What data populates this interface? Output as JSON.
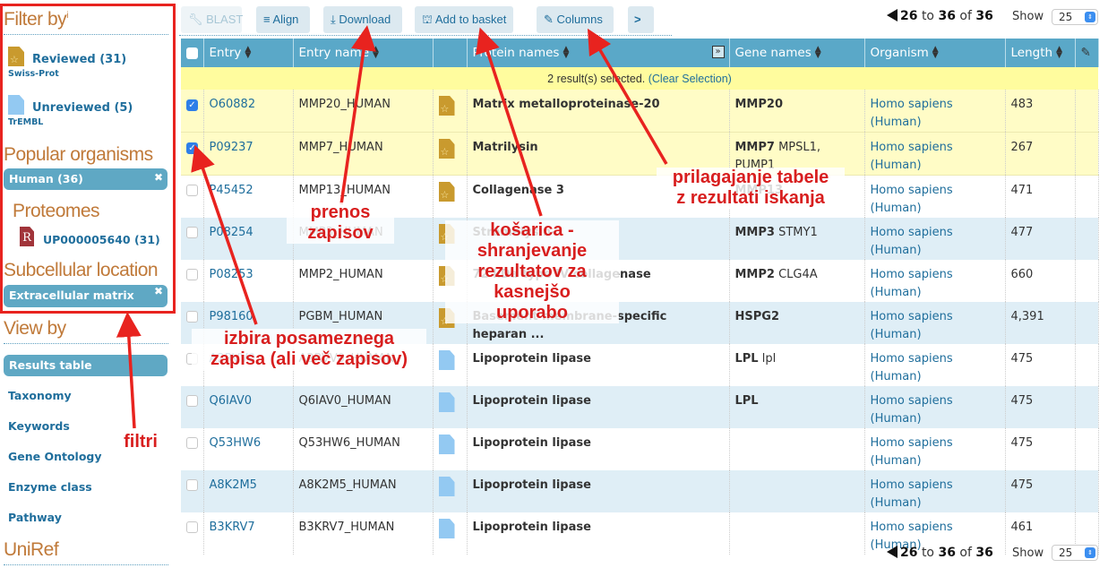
{
  "sidebar": {
    "filter_title": "Filter by",
    "filter_info": "i",
    "reviewed": {
      "label": "Reviewed (31)",
      "sub": "Swiss-Prot",
      "icon": "reviewed-doc-icon"
    },
    "unreviewed": {
      "label": "Unreviewed (5)",
      "sub": "TrEMBL",
      "icon": "unreviewed-doc-icon"
    },
    "popular_title": "Popular organisms",
    "organism_pill": "Human (36)",
    "proteomes_title": "Proteomes",
    "proteome_icon_letter": "R",
    "proteome_link": "UP000005640 (31)",
    "subcell_title": "Subcellular location",
    "subcell_pill": "Extracellular matrix",
    "remove_icon": "✖",
    "viewby_title": "View by",
    "viewby_items": [
      "Results table",
      "Taxonomy",
      "Keywords",
      "Gene Ontology",
      "Enzyme class",
      "Pathway"
    ],
    "uniref_title": "UniRef"
  },
  "toolbar": {
    "blast": "BLAST",
    "align": "Align",
    "download": "Download",
    "basket": "Add to basket",
    "columns": "Columns",
    "share_icon": "share-icon"
  },
  "pager": {
    "from": "26",
    "to_word": "to",
    "to": "36",
    "of_word": "of",
    "total": "36",
    "show_label": "Show",
    "show_value": "25"
  },
  "table": {
    "headers": [
      "Entry",
      "Entry name",
      "",
      "Protein names",
      "Gene names",
      "Organism",
      "Length"
    ],
    "selection_msg": "2 result(s) selected.",
    "clear_selection": "(Clear Selection)",
    "rows": [
      {
        "checked": true,
        "entry": "O60882",
        "entry_name": "MMP20_HUMAN",
        "status": "reviewed",
        "protein": "Matrix metalloproteinase-20",
        "gene_primary": "MMP20",
        "gene_other": "",
        "organism": "Homo sapiens (Human)",
        "length": "483"
      },
      {
        "checked": true,
        "entry": "P09237",
        "entry_name": "MMP7_HUMAN",
        "status": "reviewed",
        "protein": "Matrilysin",
        "gene_primary": "MMP7",
        "gene_other": "MPSL1, PUMP1",
        "organism": "Homo sapiens (Human)",
        "length": "267"
      },
      {
        "checked": false,
        "entry": "P45452",
        "entry_name": "MMP13_HUMAN",
        "status": "reviewed",
        "protein": "Collagenase 3",
        "gene_primary": "MMP13",
        "gene_other": "",
        "organism": "Homo sapiens (Human)",
        "length": "471"
      },
      {
        "checked": false,
        "entry": "P08254",
        "entry_name": "MMP3_HUMAN",
        "status": "reviewed",
        "protein": "Stromelysin-1",
        "gene_primary": "MMP3",
        "gene_other": "STMY1",
        "organism": "Homo sapiens (Human)",
        "length": "477"
      },
      {
        "checked": false,
        "entry": "P08253",
        "entry_name": "MMP2_HUMAN",
        "status": "reviewed",
        "protein": "72 kDa type IV collagenase",
        "gene_primary": "MMP2",
        "gene_other": "CLG4A",
        "organism": "Homo sapiens (Human)",
        "length": "660"
      },
      {
        "checked": false,
        "entry": "P98160",
        "entry_name": "PGBM_HUMAN",
        "status": "reviewed",
        "protein": "Basement membrane-specific heparan ...",
        "gene_primary": "HSPG2",
        "gene_other": "",
        "organism": "Homo sapiens (Human)",
        "length": "4,391"
      },
      {
        "checked": false,
        "entry": "A2RVV0",
        "entry_name": "A2RVV0_HUMAN",
        "status": "unreviewed",
        "protein": "Lipoprotein lipase",
        "gene_primary": "LPL",
        "gene_other": "lpl",
        "organism": "Homo sapiens (Human)",
        "length": "475"
      },
      {
        "checked": false,
        "entry": "Q6IAV0",
        "entry_name": "Q6IAV0_HUMAN",
        "status": "unreviewed",
        "protein": "Lipoprotein lipase",
        "gene_primary": "LPL",
        "gene_other": "",
        "organism": "Homo sapiens (Human)",
        "length": "475"
      },
      {
        "checked": false,
        "entry": "Q53HW6",
        "entry_name": "Q53HW6_HUMAN",
        "status": "unreviewed",
        "protein": "Lipoprotein lipase",
        "gene_primary": "",
        "gene_other": "",
        "organism": "Homo sapiens (Human)",
        "length": "475"
      },
      {
        "checked": false,
        "entry": "A8K2M5",
        "entry_name": "A8K2M5_HUMAN",
        "status": "unreviewed",
        "protein": "Lipoprotein lipase",
        "gene_primary": "",
        "gene_other": "",
        "organism": "Homo sapiens (Human)",
        "length": "475"
      },
      {
        "checked": false,
        "entry": "B3KRV7",
        "entry_name": "B3KRV7_HUMAN",
        "status": "unreviewed",
        "protein": "Lipoprotein lipase",
        "gene_primary": "",
        "gene_other": "",
        "organism": "Homo sapiens (Human)",
        "length": "461"
      }
    ]
  },
  "annotations": {
    "filters": "filtri",
    "download": "prenos\nzapisov",
    "basket": "košarica -\nshranjevanje\nrezultatov za\nkasnejšo\nuporabo",
    "columns": "prilagajanje tabele\nz rezultati iskanja",
    "select": "izbira posameznega\nzapisa (ali več zapisov)"
  },
  "colors": {
    "accent": "#5aa8c8",
    "link": "#1f6e9c",
    "heading": "#c07a3a",
    "annotation": "#d81e1e",
    "selected_row": "#fffcc6"
  }
}
